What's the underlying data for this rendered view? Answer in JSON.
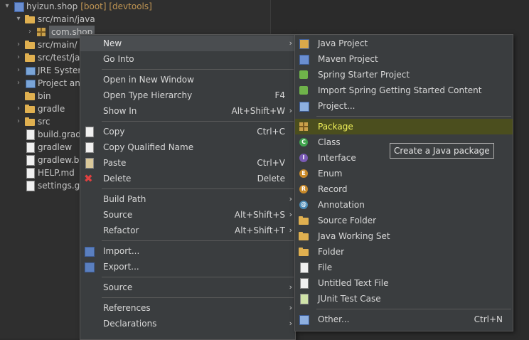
{
  "explorer": {
    "items": [
      {
        "label": "hyizun.shop",
        "decoration": "[boot] [devtools]"
      },
      {
        "label": "src/main/java"
      },
      {
        "label": "com.shop"
      },
      {
        "label": "src/main/"
      },
      {
        "label": "src/test/ja"
      },
      {
        "label": "JRE Syster"
      },
      {
        "label": "Project an"
      },
      {
        "label": "bin"
      },
      {
        "label": "gradle"
      },
      {
        "label": "src"
      },
      {
        "label": "build.grad"
      },
      {
        "label": "gradlew"
      },
      {
        "label": "gradlew.ba"
      },
      {
        "label": "HELP.md"
      },
      {
        "label": "settings.gr"
      }
    ]
  },
  "context_menu": {
    "items": [
      {
        "label": "New",
        "shortcut": ""
      },
      {
        "label": "Go Into",
        "shortcut": ""
      },
      {
        "label": "Open in New Window",
        "shortcut": ""
      },
      {
        "label": "Open Type Hierarchy",
        "shortcut": "F4"
      },
      {
        "label": "Show In",
        "shortcut": "Alt+Shift+W"
      },
      {
        "label": "Copy",
        "shortcut": "Ctrl+C"
      },
      {
        "label": "Copy Qualified Name",
        "shortcut": ""
      },
      {
        "label": "Paste",
        "shortcut": "Ctrl+V"
      },
      {
        "label": "Delete",
        "shortcut": "Delete"
      },
      {
        "label": "Build Path",
        "shortcut": ""
      },
      {
        "label": "Source",
        "shortcut": "Alt+Shift+S"
      },
      {
        "label": "Refactor",
        "shortcut": "Alt+Shift+T"
      },
      {
        "label": "Import...",
        "shortcut": ""
      },
      {
        "label": "Export...",
        "shortcut": ""
      },
      {
        "label": "Source",
        "shortcut": ""
      },
      {
        "label": "References",
        "shortcut": ""
      },
      {
        "label": "Declarations",
        "shortcut": ""
      }
    ]
  },
  "submenu": {
    "items": [
      {
        "label": "Java Project"
      },
      {
        "label": "Maven Project"
      },
      {
        "label": "Spring Starter Project"
      },
      {
        "label": "Import Spring Getting Started Content"
      },
      {
        "label": "Project..."
      },
      {
        "label": "Package"
      },
      {
        "label": "Class"
      },
      {
        "label": "Interface"
      },
      {
        "label": "Enum"
      },
      {
        "label": "Record"
      },
      {
        "label": "Annotation"
      },
      {
        "label": "Source Folder"
      },
      {
        "label": "Java Working Set"
      },
      {
        "label": "Folder"
      },
      {
        "label": "File"
      },
      {
        "label": "Untitled Text File"
      },
      {
        "label": "JUnit Test Case"
      },
      {
        "label": "Other...",
        "shortcut": "Ctrl+N"
      }
    ]
  },
  "tooltip": {
    "text": "Create a Java package"
  },
  "colors": {
    "highlight_text": "#f3f35a",
    "highlight_bg": "#4b4e1e",
    "menu_bg": "#3a3d3f"
  }
}
